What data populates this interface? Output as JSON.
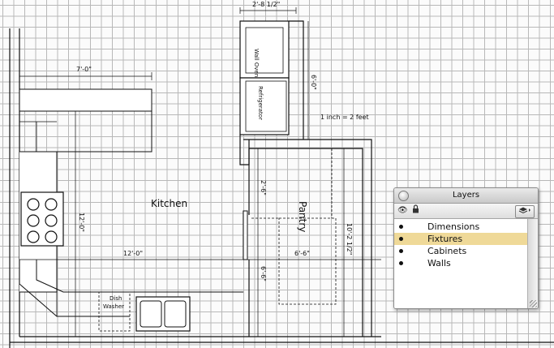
{
  "plan": {
    "room_labels": {
      "kitchen": "Kitchen",
      "pantry": "Pantry"
    },
    "fixtures": {
      "wall_oven": "Wall Oven",
      "refrigerator": "Refrigerator",
      "dish_washer_line1": "Dish",
      "dish_washer_line2": "Washer"
    },
    "dimensions": {
      "top_width": "2'-8 1/2\"",
      "counter_width": "7'-0\"",
      "fridge_column": "6'-0\"",
      "kitchen_height": "12'-0\"",
      "kitchen_width": "12'-0\"",
      "pantry_upper": "2'-6\"",
      "pantry_lower": "6'-6\"",
      "pantry_width": "6'-6\"",
      "pantry_height": "10'-2 1/2\""
    },
    "scale_note": "1 inch = 2 feet"
  },
  "layers_palette": {
    "title": "Layers",
    "toolbar_icons": [
      "eye-icon",
      "lock-icon",
      "layers-stack-icon"
    ],
    "layers": [
      {
        "name": "Dimensions",
        "visible": true,
        "selected": false
      },
      {
        "name": "Fixtures",
        "visible": true,
        "selected": true
      },
      {
        "name": "Cabinets",
        "visible": true,
        "selected": false
      },
      {
        "name": "Walls",
        "visible": true,
        "selected": false
      }
    ],
    "selection_color": "#efd998"
  }
}
